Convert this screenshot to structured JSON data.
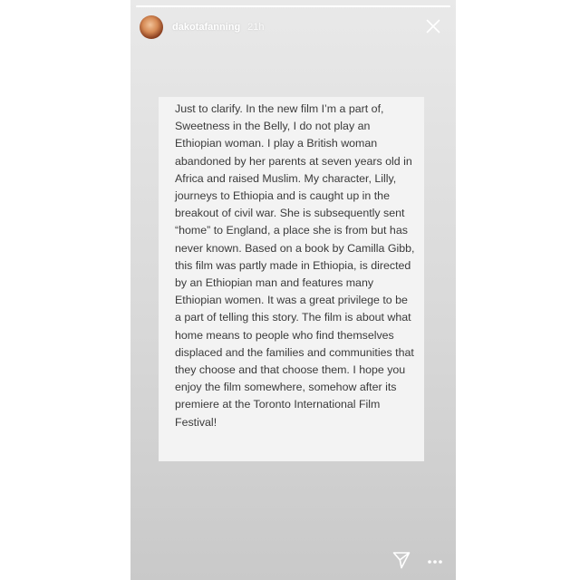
{
  "story": {
    "progress_fraction": 1.0,
    "user": {
      "username": "dakotafanning",
      "time_ago": "21h",
      "avatar_icon": "profile-photo"
    },
    "icons": {
      "close": "close-icon",
      "send": "send-icon",
      "more": "more-options-icon"
    },
    "text": "Just to clarify. In the new film I’m a part of, Sweetness in the Belly, I do not play an Ethiopian woman. I play a British woman abandoned by her parents at seven years old in Africa and raised Muslim. My character, Lilly, journeys to Ethiopia and is caught up in the breakout of civil war. She is subsequently sent “home” to England, a place she is from but has never known. Based on a book by Camilla Gibb, this film was partly made in Ethiopia, is directed by an Ethiopian man and features many Ethiopian women. It was a great privilege to be a part of telling this story. The film is about what home means to people who find themselves displaced and the families and communities that they choose and that choose them. I hope you enjoy the film somewhere, somehow after its premiere at the Toronto International Film Festival!"
  }
}
